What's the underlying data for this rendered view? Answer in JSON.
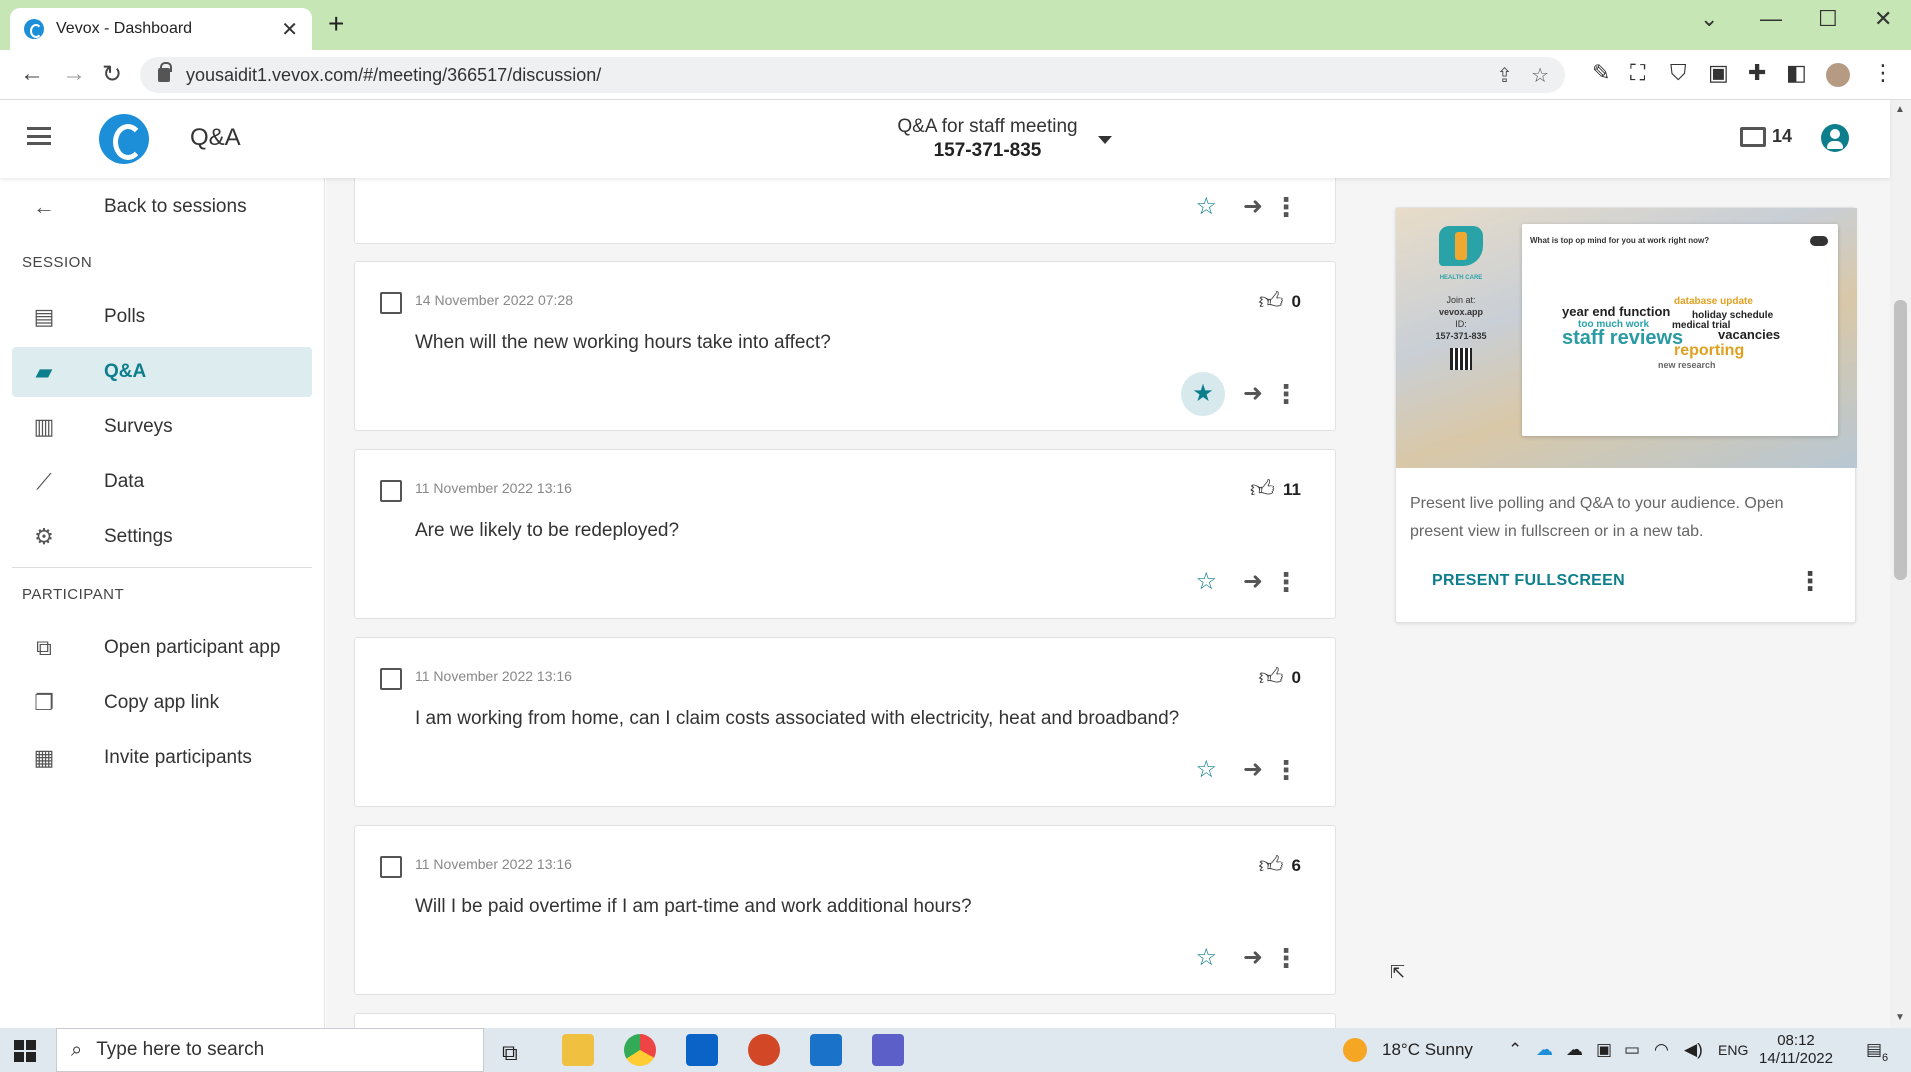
{
  "browser": {
    "tab_title": "Vevox - Dashboard",
    "tab_close": "✕",
    "new_tab": "+",
    "url": "yousaidit1.vevox.com/#/meeting/366517/discussion/"
  },
  "header": {
    "app_title": "Q&A",
    "session_name": "Q&A for staff meeting",
    "session_code": "157-371-835",
    "device_count": "14"
  },
  "sidebar": {
    "back_label": "Back to sessions",
    "session_section": "SESSION",
    "session_items": [
      {
        "label": "Polls",
        "icon": "polls-icon"
      },
      {
        "label": "Q&A",
        "icon": "qa-icon"
      },
      {
        "label": "Surveys",
        "icon": "surveys-icon"
      },
      {
        "label": "Data",
        "icon": "data-icon"
      },
      {
        "label": "Settings",
        "icon": "settings-icon"
      }
    ],
    "participant_section": "PARTICIPANT",
    "participant_items": [
      {
        "label": "Open participant app",
        "icon": "external-link-icon"
      },
      {
        "label": "Copy app link",
        "icon": "copy-icon"
      },
      {
        "label": "Invite participants",
        "icon": "calendar-icon"
      }
    ]
  },
  "questions": [
    {
      "date": "14 November 2022 07:28",
      "text": "When will the new working hours take into affect?",
      "likes": "0",
      "starred": true
    },
    {
      "date": "11 November 2022 13:16",
      "text": "Are we likely to be redeployed?",
      "likes": "11",
      "starred": false
    },
    {
      "date": "11 November 2022 13:16",
      "text": "I am working from home, can I claim costs associated with electricity, heat and broadband?",
      "likes": "0",
      "starred": false
    },
    {
      "date": "11 November 2022 13:16",
      "text": "Will I be paid overtime if I am part-time and work additional hours?",
      "likes": "6",
      "starred": false
    }
  ],
  "present": {
    "preview": {
      "brand": "HEALTH CARE",
      "join_label": "Join at:",
      "join_url": "vevox.app",
      "id_label": "ID:",
      "id_value": "157-371-835",
      "question": "What is top op mind for you at work right now?",
      "words": [
        "database update",
        "year end function",
        "holiday schedule",
        "too much work",
        "medical trial",
        "staff reviews",
        "vacancies",
        "reporting",
        "new research"
      ]
    },
    "description": "Present live polling and Q&A to your audience. Open present view in fullscreen or in a new tab.",
    "button_label": "PRESENT FULLSCREEN"
  },
  "taskbar": {
    "search_placeholder": "Type here to search",
    "weather": "18°C  Sunny",
    "language": "ENG",
    "time": "08:12",
    "date": "14/11/2022",
    "notification_count": "6"
  },
  "colors": {
    "accent": "#0d7e8c",
    "brand_blue": "#1d8fd8",
    "tabbar": "#c6e6b5"
  }
}
